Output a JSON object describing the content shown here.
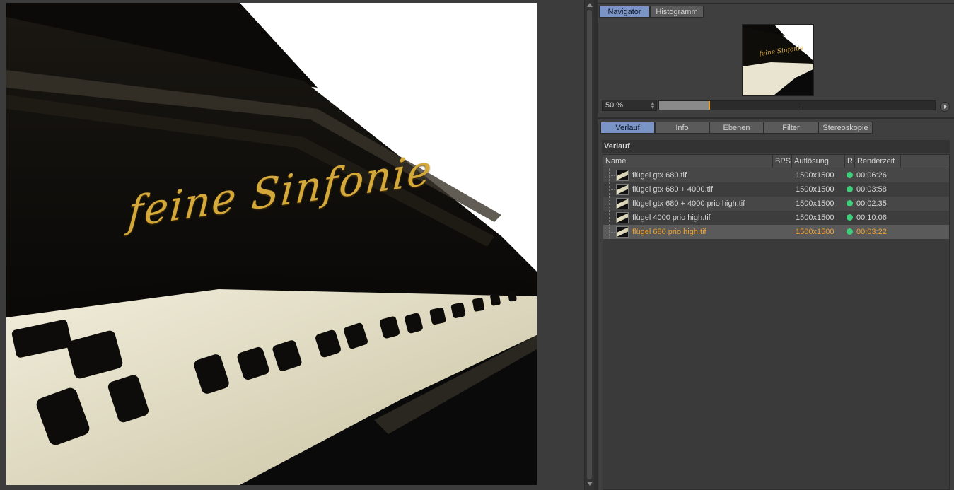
{
  "navigator_tabs": [
    {
      "label": "Navigator",
      "active": true
    },
    {
      "label": "Histogramm",
      "active": false
    }
  ],
  "zoom": {
    "value": "50 %",
    "slider_fraction": 0.18
  },
  "render": {
    "logo_text": "feine Sinfonie"
  },
  "tabs": [
    {
      "label": "Verlauf",
      "active": true
    },
    {
      "label": "Info",
      "active": false
    },
    {
      "label": "Ebenen",
      "active": false
    },
    {
      "label": "Filter",
      "active": false
    },
    {
      "label": "Stereoskopie",
      "active": false
    }
  ],
  "history": {
    "title": "Verlauf",
    "columns": {
      "name": "Name",
      "bps": "BPS",
      "resolution": "Auflösung",
      "r": "R",
      "rendertime": "Renderzeit"
    },
    "rows": [
      {
        "name": "flügel gtx 680.tif",
        "resolution": "1500x1500",
        "time": "00:06:26",
        "status_color": "#3ecf7a",
        "selected": false
      },
      {
        "name": "flügel gtx 680 + 4000.tif",
        "resolution": "1500x1500",
        "time": "00:03:58",
        "status_color": "#3ecf7a",
        "selected": false
      },
      {
        "name": "flügel gtx 680 + 4000 prio high.tif",
        "resolution": "1500x1500",
        "time": "00:02:35",
        "status_color": "#3ecf7a",
        "selected": false
      },
      {
        "name": "flügel  4000 prio high.tif",
        "resolution": "1500x1500",
        "time": "00:10:06",
        "status_color": "#3ecf7a",
        "selected": false
      },
      {
        "name": "flügel  680 prio high.tif",
        "resolution": "1500x1500",
        "time": "00:03:22",
        "status_color": "#3ecf7a",
        "selected": true
      }
    ]
  },
  "colors": {
    "active_tab": "#7a95c5",
    "selection_text": "#f0a030",
    "status_ok": "#3ecf7a",
    "slider_handle": "#f0a020"
  }
}
